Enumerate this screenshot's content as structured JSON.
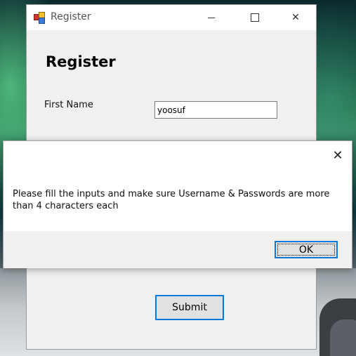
{
  "window": {
    "title": "Register",
    "heading": "Register",
    "first_name_label": "First Name",
    "first_name_value": "yoosuf",
    "submit_label": "Submit"
  },
  "dialog": {
    "message": "Please fill the inputs and make sure Username & Passwords are more than 4 characters each",
    "ok_label": "OK",
    "close_glyph": "✕"
  },
  "icons": {
    "minimize": "minimize-icon",
    "maximize": "maximize-icon",
    "close": "close-icon",
    "app": "form-app-icon"
  },
  "colors": {
    "accent": "#0078d7",
    "window_bg": "#f0f0f0",
    "titlebar_bg": "#ffffff"
  }
}
